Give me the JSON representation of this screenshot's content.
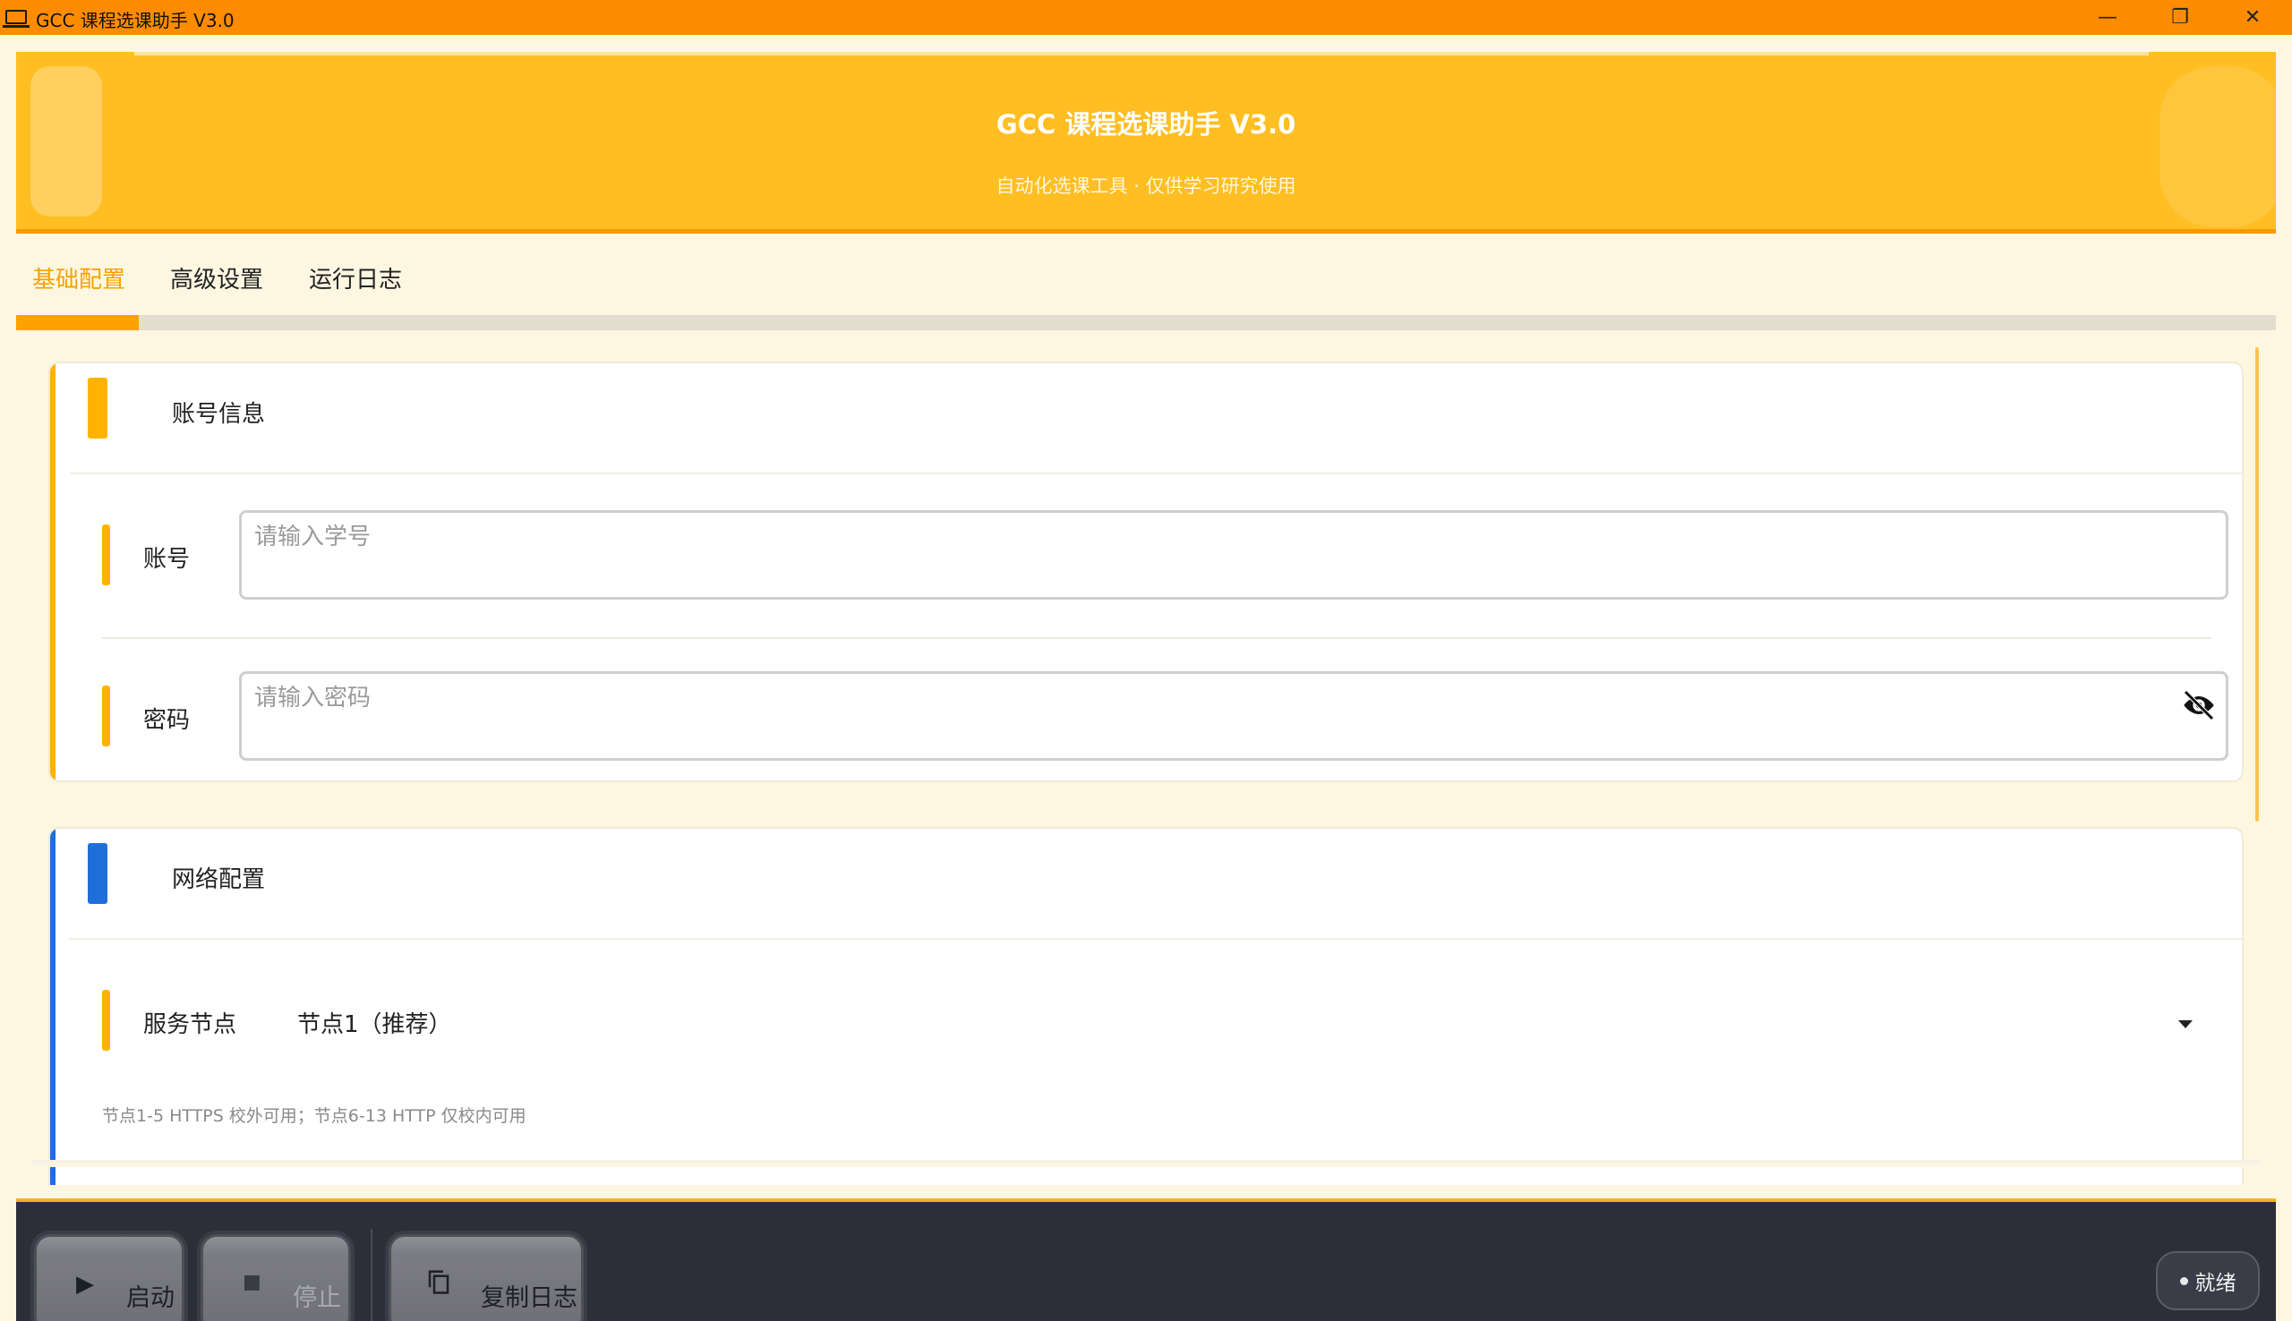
{
  "window": {
    "title": "GCC 课程选课助手  V3.0",
    "controls": {
      "minimize": "—",
      "restore": "❐",
      "close": "✕"
    }
  },
  "banner": {
    "title": "GCC 课程选课助手  V3.0",
    "subtitle": "自动化选课工具 · 仅供学习研究使用"
  },
  "tabs": [
    {
      "label": "基础配置",
      "active": true
    },
    {
      "label": "高级设置",
      "active": false
    },
    {
      "label": "运行日志",
      "active": false
    }
  ],
  "account_card": {
    "title": "账号信息",
    "accent": "#ffb300",
    "username": {
      "label": "账号",
      "value": "",
      "placeholder": "请输入学号"
    },
    "password": {
      "label": "密码",
      "value": "",
      "placeholder": "请输入密码",
      "icon": "eye-off-icon"
    }
  },
  "network_card": {
    "title": "网络配置",
    "accent": "#1e6fd9",
    "server": {
      "label": "服务节点",
      "selected": "节点1（推荐）"
    },
    "hint": "节点1-5 HTTPS 校外可用；节点6-13 HTTP 仅校内可用"
  },
  "toolbar": {
    "start_label": "启动",
    "start_icon": "play-icon",
    "stop_label": "停止",
    "stop_icon": "stop-icon",
    "copy_log_label": "复制日志",
    "copy_log_icon": "copy-icon",
    "status": "就绪"
  },
  "colors": {
    "titlebar": "#ff8c00",
    "banner": "#ffbe22",
    "active_tab": "#f5a300",
    "bottom_bar": "#2c2e3a"
  }
}
